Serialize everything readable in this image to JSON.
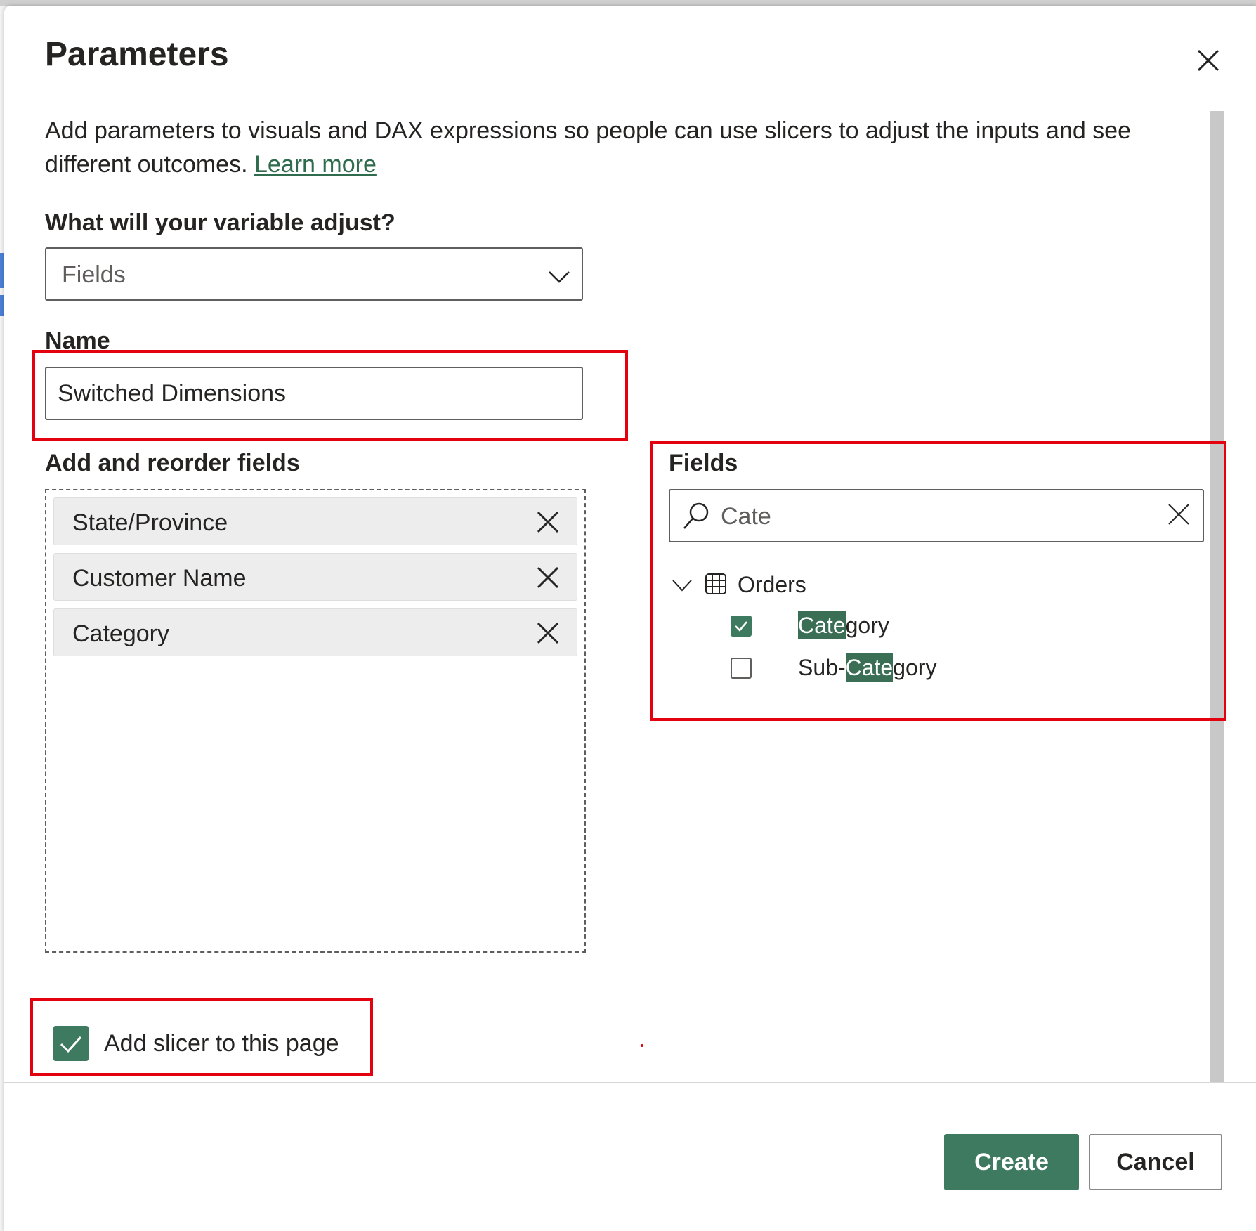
{
  "dialog": {
    "title": "Parameters",
    "description": "Add parameters to visuals and DAX expressions so people can use slicers to adjust the inputs and see different outcomes.",
    "learn_more": "Learn more"
  },
  "variable_adjust": {
    "label": "What will your variable adjust?",
    "selected": "Fields"
  },
  "name": {
    "label": "Name",
    "value": "Switched Dimensions"
  },
  "reorder": {
    "label": "Add and reorder fields",
    "items": [
      {
        "label": "State/Province"
      },
      {
        "label": "Customer Name"
      },
      {
        "label": "Category"
      }
    ]
  },
  "fields_panel": {
    "label": "Fields",
    "search_value": "Cate",
    "table": "Orders",
    "items": [
      {
        "match": "Cate",
        "rest": "gory",
        "prefix": "",
        "checked": true
      },
      {
        "prefix": "Sub-",
        "match": "Cate",
        "rest": "gory",
        "checked": false
      }
    ]
  },
  "slicer": {
    "label": "Add slicer to this page",
    "checked": true
  },
  "buttons": {
    "create": "Create",
    "cancel": "Cancel"
  },
  "colors": {
    "accent": "#3e7a60",
    "highlight_box": "#e3000f",
    "link": "#2f6b4d"
  }
}
